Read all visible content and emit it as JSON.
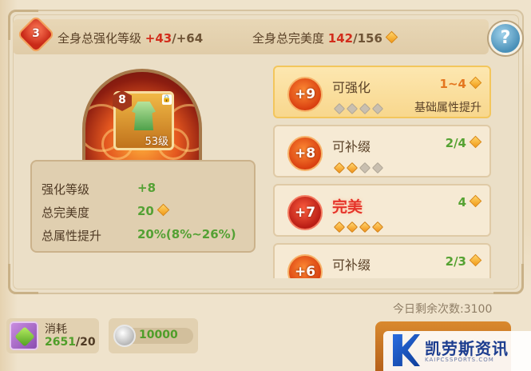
{
  "header": {
    "level_badge": "3",
    "strength_label": "全身总强化等级",
    "strength_current": "+43",
    "strength_sep": "/",
    "strength_max": "+64",
    "perfect_label": "全身总完美度",
    "perfect_current": "142",
    "perfect_sep": "/",
    "perfect_max": "156",
    "help": "?"
  },
  "equipment": {
    "stars": "8",
    "level": "53级",
    "lock": "🔒"
  },
  "stats": [
    {
      "label": "强化等级",
      "value": "+8"
    },
    {
      "label": "总完美度",
      "value": "20"
    },
    {
      "label": "总属性提升",
      "value": "20%(8%~26%)"
    }
  ],
  "options": [
    {
      "bonus": "+9",
      "title": "可强化",
      "range": "1~4",
      "range_color": "orange",
      "gems": [
        0,
        0,
        0,
        0
      ],
      "desc": "基础属性提升",
      "selected": true
    },
    {
      "bonus": "+8",
      "title": "可补缀",
      "range": "2/4",
      "range_color": "green",
      "gems": [
        1,
        1,
        0,
        0
      ],
      "desc": "",
      "selected": false
    },
    {
      "bonus": "+7",
      "title": "完美",
      "range": "4",
      "range_color": "green",
      "gems": [
        1,
        1,
        1,
        1
      ],
      "desc": "",
      "selected": false,
      "perfect": true
    },
    {
      "bonus": "+6",
      "title": "可补缀",
      "range": "2/3",
      "range_color": "green",
      "gems": [
        1,
        1,
        0,
        0
      ],
      "desc": "",
      "selected": false
    }
  ],
  "remaining": "今日剩余次数:3100",
  "cost": {
    "label": "消耗",
    "have": "2651",
    "sep": "/",
    "need": "20"
  },
  "coins": {
    "value": "10000"
  },
  "watermark": {
    "text": "凯劳斯资讯",
    "sub": "KAIPCSSPORTS.COM"
  },
  "colors": {
    "accent_red": "#d22d1c",
    "accent_green": "#54a134",
    "accent_orange": "#e4761f"
  }
}
